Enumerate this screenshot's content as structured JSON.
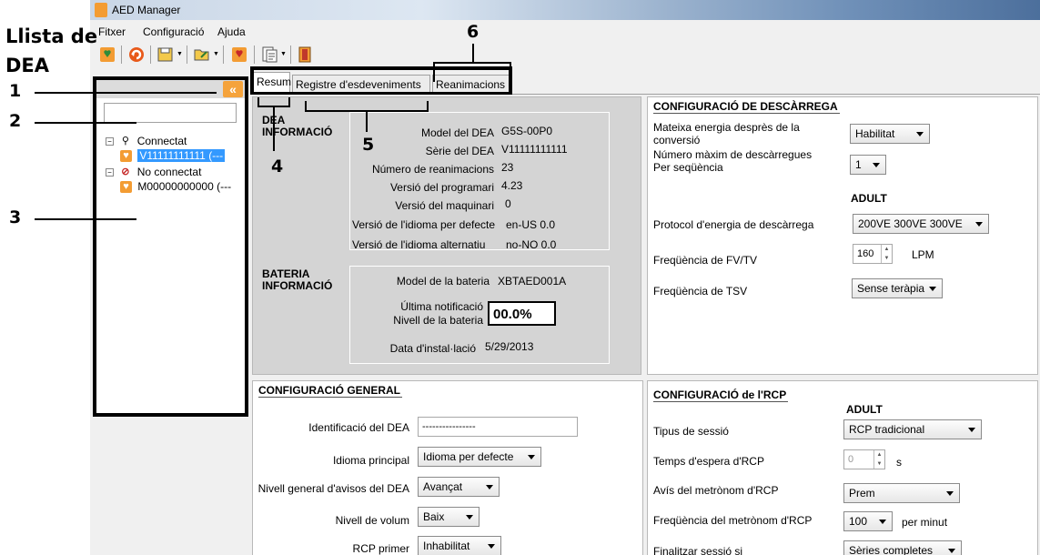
{
  "callouts": {
    "llista_line1": "Llista de",
    "llista_line2": "DEA",
    "n1": "1",
    "n2": "2",
    "n3": "3",
    "n4": "4",
    "n5": "5",
    "n6": "6"
  },
  "window": {
    "title": "AED Manager"
  },
  "menu": {
    "items": [
      "Fitxer",
      "Configuració",
      "Ajuda"
    ]
  },
  "toolbar": {
    "icons": [
      "aed-icon",
      "refresh-icon",
      "save-icon",
      "open-icon",
      "aed-device-icon",
      "report-icon",
      "exit-icon"
    ]
  },
  "tree": {
    "search_value": "",
    "groups": [
      {
        "label": "Connectat",
        "icon": "connected-plug-icon",
        "children": [
          {
            "label": "V11111111111 (---",
            "selected": true
          }
        ]
      },
      {
        "label": "No connectat",
        "icon": "disconnected-icon",
        "children": [
          {
            "label": "M00000000000 (---",
            "selected": false
          }
        ]
      }
    ]
  },
  "tabs": [
    "Resum",
    "Registre d'esdeveniments",
    "Reanimacions"
  ],
  "dea_info": {
    "heading_1": "DEA",
    "heading_2": "INFORMACIÓ",
    "rows": [
      {
        "label": "Model del DEA",
        "value": "G5S-00P0"
      },
      {
        "label": "Sèrie del DEA",
        "value": "V11111111111"
      },
      {
        "label": "Número de reanimacions",
        "value": "23"
      },
      {
        "label": "Versió del programari",
        "value": "4.23"
      },
      {
        "label": "Versió del maquinari",
        "value": "0"
      },
      {
        "label": "Versió de l'idioma per defecte",
        "value": "en-US  0.0"
      },
      {
        "label": "Versió de l'idioma alternatiu",
        "value": "no-NO  0.0"
      }
    ]
  },
  "battery_info": {
    "heading_1": "BATERIA",
    "heading_2": "INFORMACIÓ",
    "model_label": "Model de la bateria",
    "model_value": "XBTAED001A",
    "notif_label_1": "Última notificació",
    "notif_label_2": "Nivell de la bateria",
    "level_value": "00.0%",
    "install_label": "Data d'instal·lació",
    "install_value": "5/29/2013"
  },
  "shock_config": {
    "title": "CONFIGURACIÓ DE DESCÀRREGA",
    "same_energy_label_1": "Mateixa energia desprès de la",
    "same_energy_label_2": "conversió",
    "same_energy_value": "Habilitat",
    "max_shocks_label_1": "Número màxim de descàrregues",
    "max_shocks_label_2": "Per seqüència",
    "max_shocks_value": "1",
    "adult_header": "ADULT",
    "protocol_label": "Protocol d'energia de descàrrega",
    "protocol_value": "200VE 300VE 300VE",
    "vf_label": "Freqüència de FV/TV",
    "vf_value": "160",
    "vf_unit": "LPM",
    "svt_label": "Freqüència de TSV",
    "svt_value": "Sense teràpia"
  },
  "general_config": {
    "title": "CONFIGURACIÓ GENERAL",
    "id_label": "Identificació del DEA",
    "id_value": "----------------",
    "lang_label": "Idioma principal",
    "lang_value": "Idioma per defecte",
    "warn_label": "Nivell general d'avisos del DEA",
    "warn_value": "Avançat",
    "volume_label": "Nivell de volum",
    "volume_value": "Baix",
    "cpr_first_label": "RCP primer",
    "cpr_first_value": "Inhabilitat"
  },
  "cpr_config": {
    "title": "CONFIGURACIÓ de l'RCP",
    "adult_header": "ADULT",
    "session_label": "Tipus de sessió",
    "session_value": "RCP tradicional",
    "wait_label": "Temps d'espera d'RCP",
    "wait_value": "0",
    "wait_unit": "s",
    "metro_label": "Avís del metrònom d'RCP",
    "metro_value": "Prem",
    "metro_rate_label": "Freqüència del metrònom d'RCP",
    "metro_rate_value": "100",
    "metro_rate_unit": "per minut",
    "end_label": "Finalitzar sessió si",
    "end_value": "Sèries completes"
  }
}
